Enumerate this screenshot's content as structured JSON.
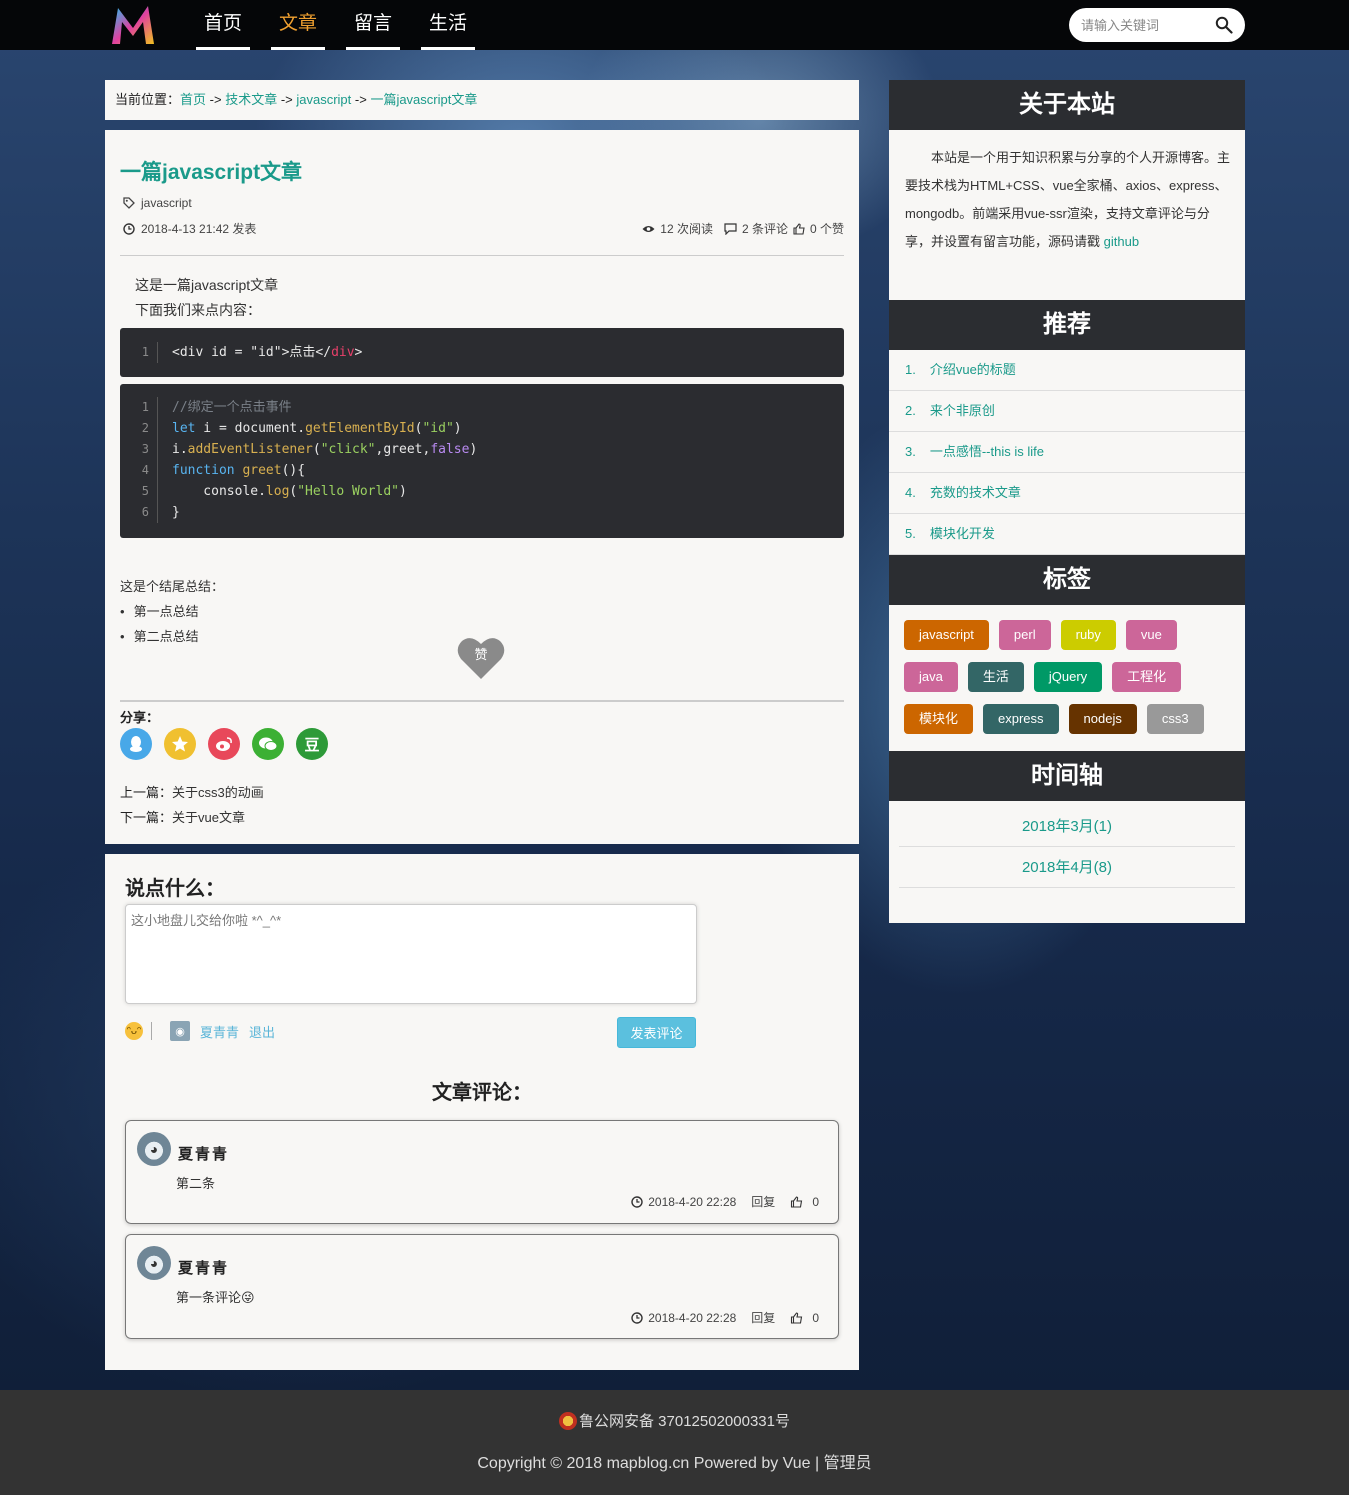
{
  "nav": {
    "items": [
      "首页",
      "文章",
      "留言",
      "生活"
    ],
    "active": 1
  },
  "search": {
    "placeholder": "请输入关键词"
  },
  "breadcrumb": {
    "prefix": "当前位置：",
    "items": [
      "首页",
      "技术文章",
      "javascript",
      "一篇javascript文章"
    ],
    "sep": " -> "
  },
  "article": {
    "title": "一篇javascript文章",
    "tag": "javascript",
    "date": "2018-4-13 21:42 发表",
    "reads": "12 次阅读",
    "comments": "2 条评论",
    "likes": "0 个赞",
    "intro1": "这是一篇javascript文章",
    "intro2": "下面我们来点内容：",
    "summary": "这是个结尾总结：",
    "points": [
      "第一点总结",
      "第二点总结"
    ],
    "like_label": "赞",
    "share_label": "分享：",
    "prev_label": "上一篇：",
    "prev_title": "关于css3的动画",
    "next_label": "下一篇：",
    "next_title": "关于vue文章"
  },
  "comment_form": {
    "heading": "说点什么：",
    "placeholder": "这小地盘儿交给你啦 *^_^*",
    "username": "夏青青",
    "logout": "退出",
    "submit": "发表评论"
  },
  "comments": {
    "heading": "文章评论：",
    "items": [
      {
        "name": "夏青青",
        "text": "第二条",
        "time": "2018-4-20 22:28",
        "reply": "回复",
        "likes": "0"
      },
      {
        "name": "夏青青",
        "text": "第一条评论😜",
        "time": "2018-4-20 22:28",
        "reply": "回复",
        "likes": "0"
      }
    ]
  },
  "sidebar": {
    "about_title": "关于本站",
    "about_text": "本站是一个用于知识积累与分享的个人开源博客。主要技术栈为HTML+CSS、vue全家桶、axios、express、mongodb。前端采用vue-ssr渲染，支持文章评论与分享，并设置有留言功能，源码请戳 ",
    "about_link": "github",
    "rec_title": "推荐",
    "recommend": [
      "介绍vue的标题",
      "来个非原创",
      "一点感悟--this is life",
      "充数的技术文章",
      "模块化开发"
    ],
    "tags_title": "标签",
    "tags": [
      {
        "label": "javascript",
        "color": "#cc6600"
      },
      {
        "label": "perl",
        "color": "#cc6699"
      },
      {
        "label": "ruby",
        "color": "#cccc00"
      },
      {
        "label": "vue",
        "color": "#cc6699"
      },
      {
        "label": "java",
        "color": "#cc6699"
      },
      {
        "label": "生活",
        "color": "#336666"
      },
      {
        "label": "jQuery",
        "color": "#009966"
      },
      {
        "label": "工程化",
        "color": "#cc6699"
      },
      {
        "label": "模块化",
        "color": "#cc6600"
      },
      {
        "label": "express",
        "color": "#336666"
      },
      {
        "label": "nodejs",
        "color": "#663300"
      },
      {
        "label": "css3",
        "color": "#999999"
      }
    ],
    "timeline_title": "时间轴",
    "timeline": [
      "2018年3月(1)",
      "2018年4月(8)"
    ]
  },
  "footer": {
    "beian": "鲁公网安备 37012502000331号",
    "copyright": "Copyright © 2018  mapblog.cn  Powered by Vue | 管理员"
  }
}
